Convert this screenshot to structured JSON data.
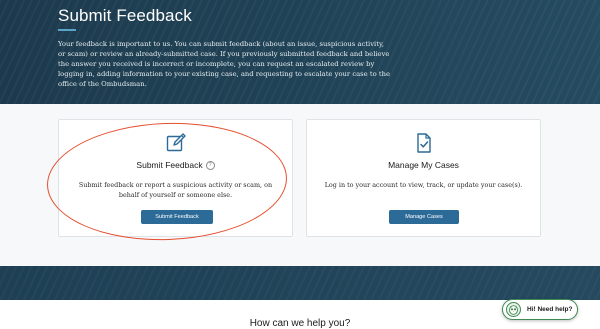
{
  "hero": {
    "title": "Submit Feedback",
    "description": "Your feedback is important to us. You can submit feedback (about an issue, suspicious activity, or scam) or review an already-submitted case. If you previously submitted feedback and believe the answer you received is incorrect or incomplete, you can request an escalated review by logging in, adding information to your existing case, and requesting to escalate your case to the office of the Ombudsman."
  },
  "cards": [
    {
      "icon": "pencil-square-icon",
      "title": "Submit Feedback",
      "help_symbol": "?",
      "text": "Submit feedback or report a suspicious activity or scam, on behalf of yourself or someone else.",
      "button_label": "Submit Feedback"
    },
    {
      "icon": "document-check-icon",
      "title": "Manage My Cases",
      "text": "Log in to your account to view, track, or update your case(s).",
      "button_label": "Manage Cases"
    }
  ],
  "help_section": {
    "heading": "How can we help you?"
  },
  "chat": {
    "label": "Hi! Need help?",
    "icon": "owl-icon"
  },
  "colors": {
    "hero_bg": "#1e3f52",
    "accent_rule": "#5aa3c9",
    "button_bg": "#2c6a97",
    "annotation": "#e54e2f",
    "chat_border": "#3f8a52"
  }
}
